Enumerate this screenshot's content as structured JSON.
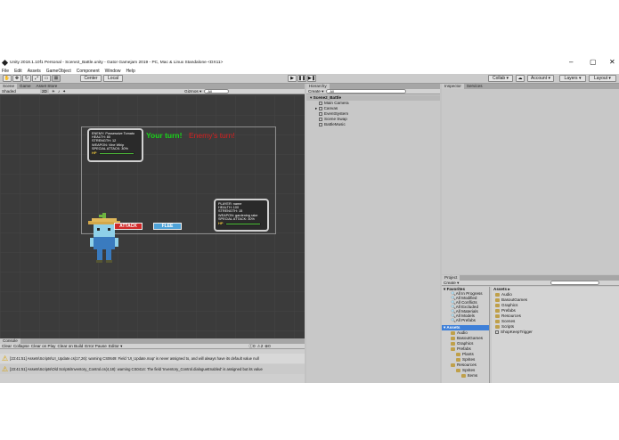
{
  "window": {
    "title": "Unity 2018.1.10f1 Personal - Scene2_Battle.unity - Gator Gamejam 2019 - PC, Mac & Linux Standalone <DX11>",
    "controls": [
      "–",
      "▢",
      "✕"
    ]
  },
  "menu": [
    "File",
    "Edit",
    "Assets",
    "GameObject",
    "Component",
    "Window",
    "Help"
  ],
  "toolbar": {
    "pivot": "Center",
    "space": "Local",
    "collab": "Collab ▾",
    "account": "Account ▾",
    "layers": "Layers ▾",
    "layout": "Layout ▾"
  },
  "scene_panel": {
    "tabs": [
      "Scene",
      "Game",
      "Asset Store"
    ],
    "shading": "Shaded",
    "mode_2d": "2D",
    "gizmos": "Gizmos ▾",
    "search_placeholder": "All"
  },
  "game": {
    "enemy_stats": [
      "ENEMY: Possessive Tomato",
      "HEALTH: 80",
      "STRENGTH: 12",
      "WEAPON: Vine Whip",
      "SPECIAL ATTACK: 30%"
    ],
    "player_stats": [
      "PLAYER: name",
      "HEALTH: 100",
      "STRENGTH: 15",
      "WEAPON: gardening rake",
      "SPECIAL ATTACK: 30%"
    ],
    "hp_label": "HP",
    "turn_text": "Your turn!",
    "enemy_turn_text": "Enemy's turn!",
    "attack_label": "ATTACK",
    "flee_label": "FLEE",
    "colors": {
      "turn": "#19d219",
      "enemy_turn": "#d62020",
      "hp": "#4fc23a"
    }
  },
  "hierarchy": {
    "tab": "Hierarchy",
    "create": "Create ▾",
    "search_placeholder": "All",
    "scene": "Scene2_Battle",
    "items": [
      "Main Camera",
      "Canvas",
      "EventSystem",
      "Scene Swap",
      "BattleMusic"
    ]
  },
  "inspector": {
    "tabs": [
      "Inspector",
      "Services"
    ]
  },
  "console": {
    "tab": "Console",
    "buttons": [
      "Clear",
      "Collapse",
      "Clear on Play",
      "Clear on Build",
      "Error Pause",
      "Editor ▾"
    ],
    "counts": [
      "0",
      "2",
      "0"
    ],
    "messages": [
      "[23:41:51] Assets\\Scripts\\UI_Update.cs(17,26): warning CS0649: Field 'UI_Update.map' is never assigned to, and will always have its default value null",
      "[23:41:51] Assets\\Scripts\\Old Scripts\\Inventory_Control.cs(4,18): warning CS0414: The field 'Inventory_Control.dialogueEnabled' is assigned but its value"
    ]
  },
  "project": {
    "tab": "Project",
    "create": "Create ▾",
    "favorites_label": "Favorites",
    "favorites": [
      "All In Progress",
      "All Modified",
      "All Conflicts",
      "All Excluded",
      "All Materials",
      "All Models",
      "All Prefabs"
    ],
    "assets_root": "Assets",
    "tree": [
      "Audio",
      "BasoutGames",
      "Graphics",
      "Prefabs",
      "Plants",
      "Sprites",
      "Resources",
      "Sprites",
      "Items"
    ],
    "breadcrumb": "Assets ▸",
    "assets": [
      "Audio",
      "BasoutGames",
      "Graphics",
      "Prefabs",
      "Resources",
      "Scenes",
      "Scripts",
      "ShopKeepTrigger"
    ]
  }
}
